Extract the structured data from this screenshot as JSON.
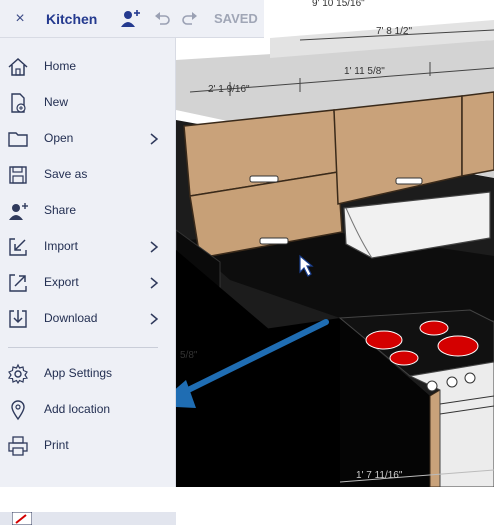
{
  "topbar": {
    "close_glyph": "×",
    "title": "Kitchen",
    "saved_label": "SAVED",
    "icons": [
      "close-icon",
      "add-user-icon",
      "undo-icon",
      "redo-icon"
    ]
  },
  "menu": {
    "items": [
      {
        "label": "Home",
        "icon": "home-icon"
      },
      {
        "label": "New",
        "icon": "new-file-icon"
      },
      {
        "label": "Open",
        "icon": "folder-icon",
        "submenu": true
      },
      {
        "label": "Save as",
        "icon": "save-icon"
      },
      {
        "label": "Share",
        "icon": "share-user-icon"
      },
      {
        "label": "Import",
        "icon": "import-icon",
        "submenu": true
      },
      {
        "label": "Export",
        "icon": "export-icon",
        "submenu": true
      },
      {
        "label": "Download",
        "icon": "download-icon",
        "submenu": true
      },
      {
        "label": "App Settings",
        "icon": "gear-icon"
      },
      {
        "label": "Add location",
        "icon": "location-pin-icon"
      },
      {
        "label": "Print",
        "icon": "printer-icon"
      }
    ]
  },
  "scene": {
    "dimensions": [
      "9' 10 15/16\"",
      "7' 8 1/2\"",
      "2' 1 9/16\"",
      "1' 11 5/8\"",
      "5/8\"",
      "1' 7 11/16\""
    ],
    "colors": {
      "cabinet": "#c9a27a",
      "countertop": "#111111",
      "cooktop_burner": "#d40000",
      "arrow": "#1f6db3",
      "menu_bg": "#eef0f6",
      "brand_text": "#243a8f"
    }
  }
}
